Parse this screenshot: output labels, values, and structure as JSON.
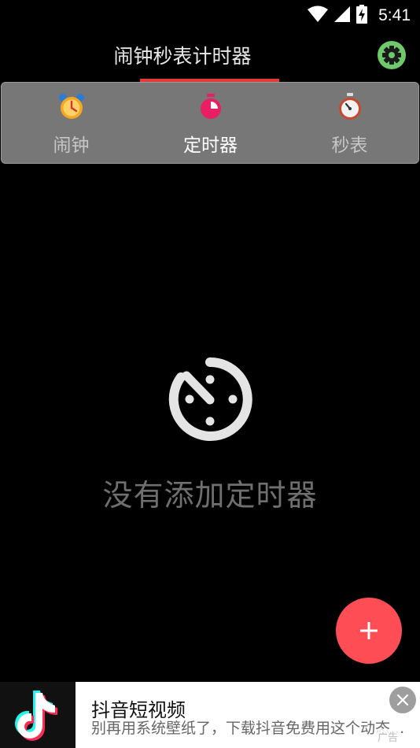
{
  "status_bar": {
    "time": "5:41",
    "icons": [
      "wifi-icon",
      "cell-signal-icon",
      "battery-charging-icon"
    ]
  },
  "app": {
    "title": "闹钟秒表计时器",
    "settings_icon": "gear-icon"
  },
  "tabs": [
    {
      "label": "闹钟",
      "icon": "alarm-clock-icon",
      "active": false
    },
    {
      "label": "定时器",
      "icon": "timer-icon",
      "active": true
    },
    {
      "label": "秒表",
      "icon": "stopwatch-icon",
      "active": false
    }
  ],
  "empty_state": {
    "icon": "timer-outline-icon",
    "message": "没有添加定时器"
  },
  "fab": {
    "icon": "plus-icon"
  },
  "ad": {
    "title": "抖音短视频",
    "description": "别再用系统壁纸了，下载抖音免费用这个动态...",
    "tag": "广告",
    "logo_icon": "tiktok-logo-icon",
    "close_icon": "close-icon"
  },
  "colors": {
    "accent": "#ff4d55",
    "tab_indicator": "#e53935",
    "tab_bar_bg": "#777777",
    "settings_green": "#6dc96a"
  }
}
